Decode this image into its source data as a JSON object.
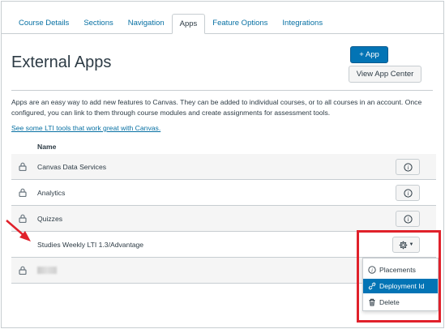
{
  "tabs": [
    {
      "label": "Course Details",
      "active": false
    },
    {
      "label": "Sections",
      "active": false
    },
    {
      "label": "Navigation",
      "active": false
    },
    {
      "label": "Apps",
      "active": true
    },
    {
      "label": "Feature Options",
      "active": false
    },
    {
      "label": "Integrations",
      "active": false
    }
  ],
  "header": {
    "title": "External Apps",
    "add_app_label": "+ App",
    "view_app_center_label": "View App Center"
  },
  "description": "Apps are an easy way to add new features to Canvas. They can be added to individual courses, or to all courses in an account. Once configured, you can link to them through course modules and create assignments for assessment tools.",
  "lti_link": "See some LTI tools that work great with Canvas.",
  "table": {
    "column_name": "Name",
    "rows": [
      {
        "name": "Canvas Data Services",
        "locked": true,
        "action": "info"
      },
      {
        "name": "Analytics",
        "locked": true,
        "action": "info"
      },
      {
        "name": "Quizzes",
        "locked": true,
        "action": "info"
      },
      {
        "name": "Studies Weekly LTI 1.3/Advantage",
        "locked": false,
        "action": "gear"
      },
      {
        "name": "",
        "locked": true,
        "action": "none",
        "redacted": true
      }
    ]
  },
  "gear_menu": {
    "items": [
      {
        "label": "Placements",
        "icon": "info-icon",
        "highlighted": false
      },
      {
        "label": "Deployment Id",
        "icon": "link-icon",
        "highlighted": true
      },
      {
        "label": "Delete",
        "icon": "trash-icon",
        "highlighted": false
      }
    ]
  },
  "colors": {
    "accent": "#0374b5",
    "link": "#0770a3",
    "annotation": "#e0212b"
  }
}
